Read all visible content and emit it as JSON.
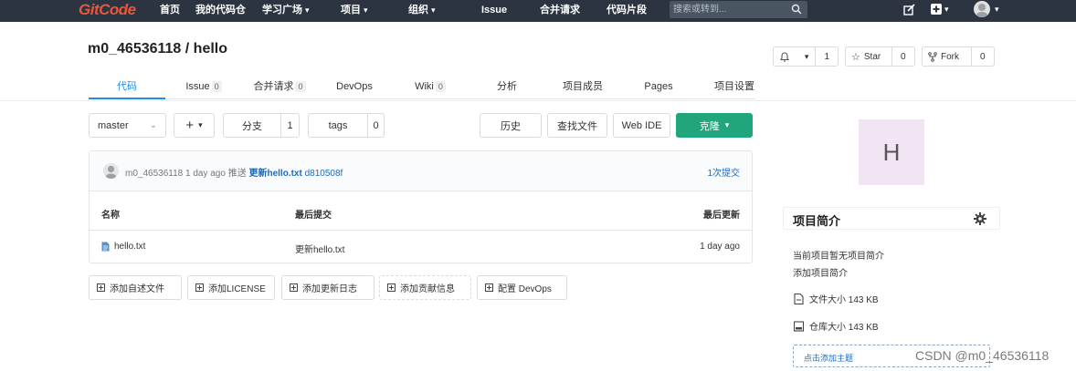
{
  "topbar": {
    "logo": "GitCode",
    "nav": [
      {
        "label": "首页",
        "caret": false
      },
      {
        "label": "我的代码仓",
        "caret": false
      },
      {
        "label": "学习广场",
        "caret": true
      },
      {
        "label": "项目",
        "caret": true
      },
      {
        "label": "组织",
        "caret": true
      },
      {
        "label": "Issue",
        "caret": false
      },
      {
        "label": "合并请求",
        "caret": false
      },
      {
        "label": "代码片段",
        "caret": false
      }
    ],
    "search_placeholder": "搜索或转到..."
  },
  "project": {
    "title": "m0_46536118 / hello",
    "watch_count": "1",
    "star_label": "Star",
    "star_count": "0",
    "fork_label": "Fork",
    "fork_count": "0"
  },
  "tabs": [
    {
      "label": "代码",
      "badge": null,
      "active": true
    },
    {
      "label": "Issue",
      "badge": "0",
      "active": false
    },
    {
      "label": "合并请求",
      "badge": "0",
      "active": false
    },
    {
      "label": "DevOps",
      "badge": null,
      "active": false
    },
    {
      "label": "Wiki",
      "badge": "0",
      "active": false
    },
    {
      "label": "分析",
      "badge": null,
      "active": false
    },
    {
      "label": "项目成员",
      "badge": null,
      "active": false
    },
    {
      "label": "Pages",
      "badge": null,
      "active": false
    },
    {
      "label": "项目设置",
      "badge": null,
      "active": false
    }
  ],
  "toolbar": {
    "branch": "master",
    "branches_label": "分支",
    "branches_count": "1",
    "tags_label": "tags",
    "tags_count": "0",
    "history": "历史",
    "find_file": "查找文件",
    "web_ide": "Web IDE",
    "clone": "克隆"
  },
  "commit": {
    "author": "m0_46536118",
    "time": "1 day ago",
    "action": "推送",
    "message": "更新hello.txt",
    "sha": "d810508f",
    "count_label": "1次提交"
  },
  "file_table": {
    "headers": [
      "名称",
      "最后提交",
      "最后更新"
    ],
    "rows": [
      {
        "name": "hello.txt",
        "last_commit": "更新hello.txt",
        "updated": "1 day ago"
      }
    ]
  },
  "add_buttons": [
    "添加自述文件",
    "添加LICENSE",
    "添加更新日志",
    "添加贡献信息",
    "配置 DevOps"
  ],
  "sidebar": {
    "avatar_letter": "H",
    "title": "项目简介",
    "no_desc": "当前项目暂无项目简介",
    "add_desc": "添加项目简介",
    "file_size": "文件大小 143 KB",
    "repo_size": "仓库大小 143 KB",
    "add_topic": "点击添加主题"
  },
  "watermark": "CSDN @m0_46536118",
  "colors": {
    "topbar": "#2b3440",
    "accent": "#1f8ce6",
    "clone_button": "#21a57c",
    "logo": "#e8573a"
  }
}
